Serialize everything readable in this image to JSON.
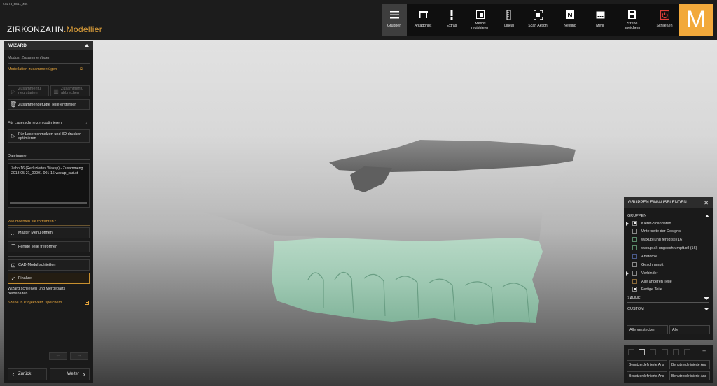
{
  "version": "v.8173_8841_x64",
  "brand": {
    "name": "ZIRKONZAHN",
    "product": ".Modellier"
  },
  "toolbar": {
    "main": [
      {
        "label": "Gruppen",
        "icon": "list-icon"
      },
      {
        "label": "Antagonist",
        "icon": "antagonist-icon"
      },
      {
        "label": "Extras",
        "icon": "exclamation-icon"
      },
      {
        "label": "Meshs registrieren",
        "icon": "mesh-register-icon"
      },
      {
        "label": "Lineal",
        "icon": "ruler-icon"
      },
      {
        "label": "Scan Aktion",
        "icon": "scan-icon"
      },
      {
        "label": "Nesting",
        "icon": "nesting-icon"
      }
    ],
    "side": [
      {
        "label": "Mehr",
        "icon": "more-icon"
      },
      {
        "label": "Szene speichern",
        "icon": "save-icon"
      },
      {
        "label": "Schließen",
        "icon": "power-icon"
      }
    ],
    "logo": "M"
  },
  "wizard": {
    "title": "WIZARD",
    "modus": "Modus: Zusammenfügen",
    "section1": "Modellation zusammenfügen",
    "btn_start": "Zusammenfü neu starten",
    "btn_abort": "Zusammenfü abbrechen",
    "btn_remove": "Zusammengefügte Teile entfernen",
    "section2": "Für Laserschmelzen optimieren",
    "btn_optimize": "Für Laserschmelzen und 3D drucken optimieren",
    "filename_label": "Dateiname:",
    "filename_line1": "Zahn 16 (Reduziertes Waxup) - Zusammeng",
    "filename_line2": "2018-05-21_00001-001-16-waxup_cad.stl",
    "question": "Wie möchten sie fortfahren?",
    "btn_master": "Master Menü öffnen",
    "btn_finished": "Fertige Teile freiformen",
    "btn_cad_close": "CAD-Modul schließen",
    "btn_finalize": "Finalize",
    "info": "Wizard schließen und Mergeparts beibehalten",
    "save_scene": "Szene in Projektverz. speichern",
    "back": "Zurück",
    "next": "Weiter"
  },
  "groups": {
    "title": "GRUPPEN EIN/AUSBLENDEN",
    "section": "GRUPPEN",
    "items": [
      {
        "label": "Kiefer-Scandaten",
        "checked": true,
        "expand": true
      },
      {
        "label": "Unterseite der Designs",
        "checked": false,
        "expand": false
      },
      {
        "label": "waxup jung fertig.stl (16)",
        "checked": false,
        "expand": false
      },
      {
        "label": "waxup alt ungeschrumpft.stl (16)",
        "checked": false,
        "expand": false
      },
      {
        "label": "Anatomie",
        "checked": false,
        "expand": false
      },
      {
        "label": "Geschrumpft",
        "checked": false,
        "expand": false
      },
      {
        "label": "Verbinder",
        "checked": false,
        "expand": true
      },
      {
        "label": "Alle anderen Teile",
        "checked": false,
        "expand": false
      },
      {
        "label": "Fertige Teile",
        "checked": true,
        "expand": false
      }
    ],
    "section_teeth": "ZÄHNE",
    "section_custom": "CUSTOM",
    "hide_all": "Alle verstecken",
    "all": "Alle",
    "custom_buttons": [
      "Benutzerdefinierte Ans",
      "Benutzerdefinierte Ans",
      "Benutzerdefinierte Ans",
      "Benutzerdefinierte Ans"
    ]
  },
  "colors": {
    "accent": "#e3a33b",
    "logo_bg": "#f2a93b",
    "close_red": "#e0403a",
    "tooth_green": "#9fc9b3"
  }
}
